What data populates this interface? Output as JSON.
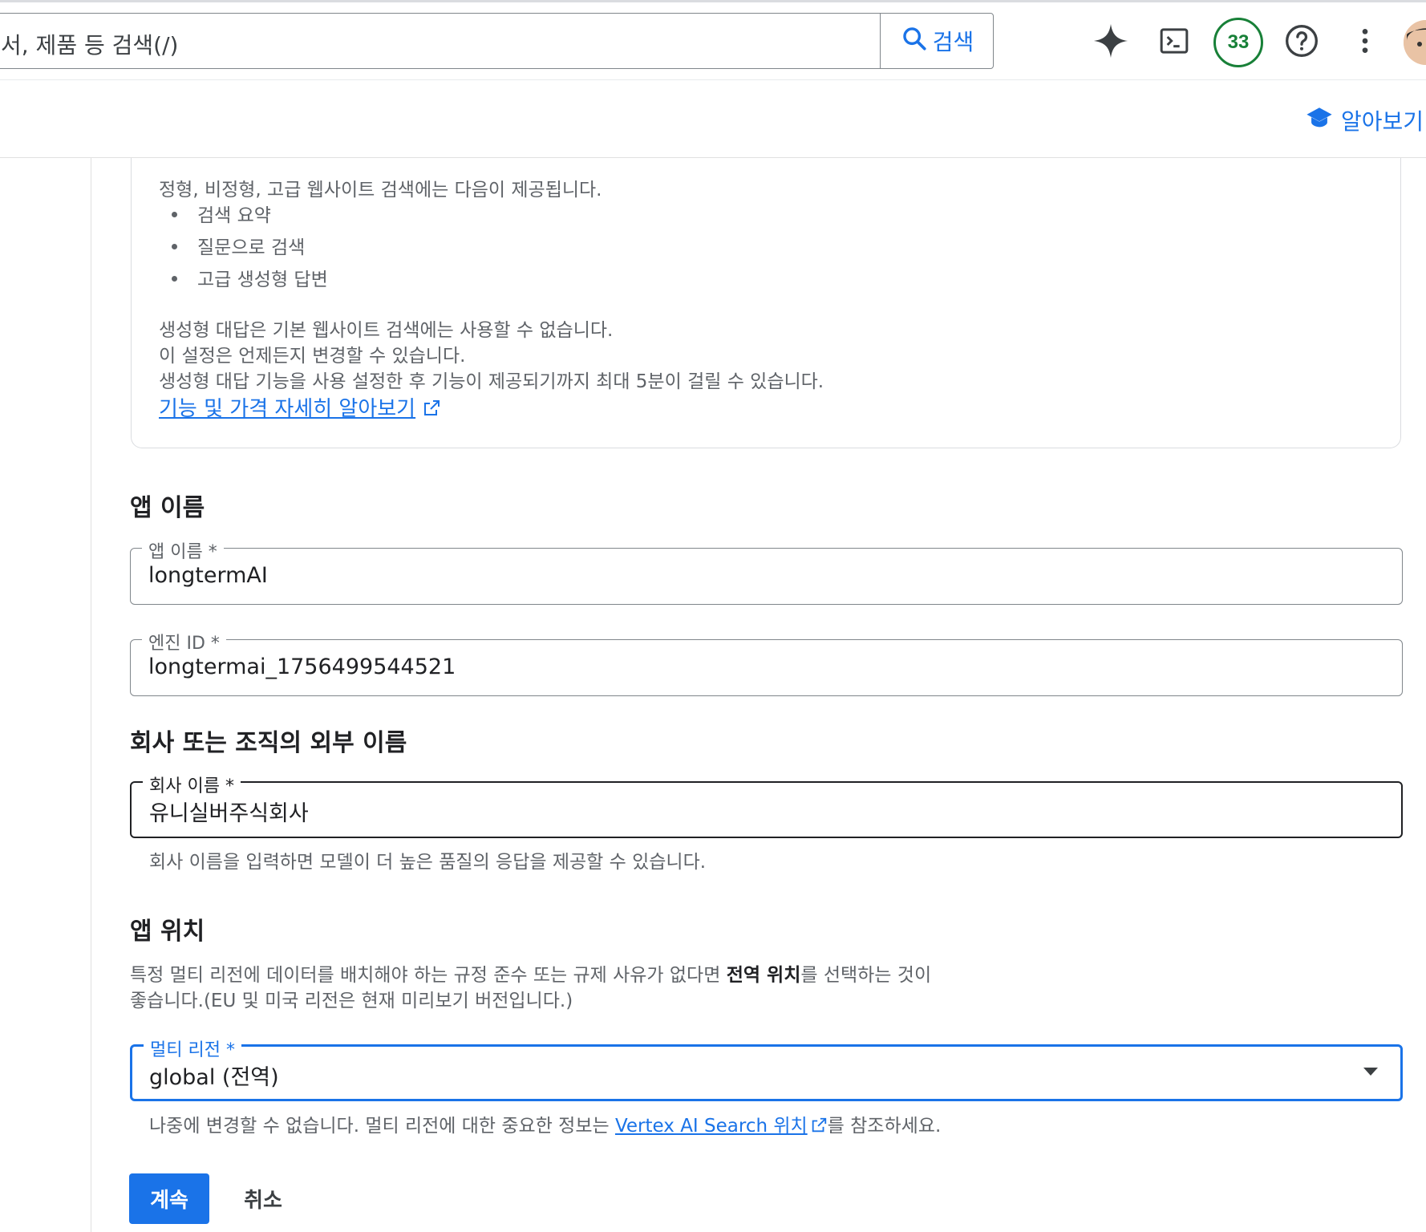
{
  "header": {
    "search_placeholder": "서, 제품 등 검색(/)",
    "search_button_label": "검색",
    "notification_count": "33"
  },
  "subheader": {
    "learn_label": "알아보기"
  },
  "info_card": {
    "intro": "정형, 비정형, 고급 웹사이트 검색에는 다음이 제공됩니다.",
    "bullets": [
      "검색 요약",
      "질문으로 검색",
      "고급 생성형 답변"
    ],
    "note_1": "생성형 대답은 기본 웹사이트 검색에는 사용할 수 없습니다.",
    "note_2": "이 설정은 언제든지 변경할 수 있습니다.",
    "note_3": "생성형 대답 기능을 사용 설정한 후 기능이 제공되기까지 최대 5분이 걸릴 수 있습니다.",
    "link_label": "기능 및 가격 자세히 알아보기"
  },
  "app_name_section": {
    "heading": "앱 이름",
    "app_name_label": "앱 이름 *",
    "app_name_value": "longtermAI",
    "engine_id_label": "엔진 ID *",
    "engine_id_value": "longtermai_1756499544521"
  },
  "company_section": {
    "heading": "회사 또는 조직의 외부 이름",
    "company_label": "회사 이름 *",
    "company_value": "유니실버주식회사",
    "company_hint": "회사 이름을 입력하면 모델이 더 높은 품질의 응답을 제공할 수 있습니다."
  },
  "location_section": {
    "heading": "앱 위치",
    "desc_line1_a": "특정 멀티 리전에 데이터를 배치해야 하는 규정 준수 또는 규제 사유가 없다면 ",
    "desc_line1_bold": "전역 위치",
    "desc_line1_b": "를 선택하는 것이",
    "desc_line2": "좋습니다.(EU 및 미국 리전은 현재 미리보기 버전입니다.)",
    "region_label": "멀티 리전 *",
    "region_value": "global (전역)",
    "hint_a": "나중에 변경할 수 없습니다. 멀티 리전에 대한 중요한 정보는 ",
    "hint_link": "Vertex AI Search 위치",
    "hint_b": "를 참조하세요."
  },
  "actions": {
    "continue_label": "계속",
    "cancel_label": "취소"
  },
  "colors": {
    "accent": "#1a73e8",
    "badge_green": "#188038"
  }
}
